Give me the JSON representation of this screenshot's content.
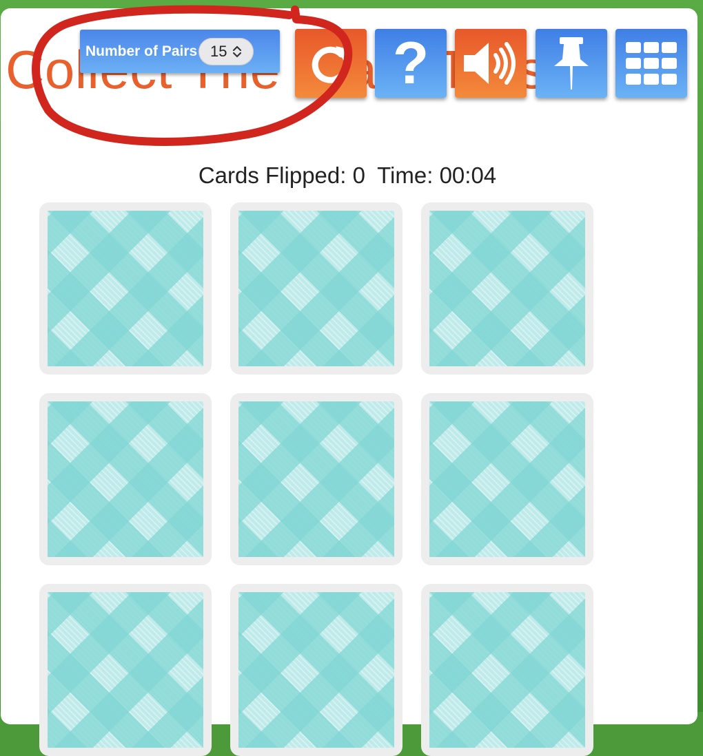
{
  "game": {
    "title": "Collect The Stars Twist",
    "number_of_pairs_label": "Number of Pairs",
    "number_of_pairs_value": "15"
  },
  "toolbar": {
    "buttons": [
      {
        "icon": "restart-icon",
        "color": "orange"
      },
      {
        "icon": "help-icon",
        "glyph": "?",
        "color": "blue"
      },
      {
        "icon": "sound-icon",
        "color": "orange"
      },
      {
        "icon": "pin-icon",
        "color": "blue"
      },
      {
        "icon": "grid-icon",
        "color": "blue"
      }
    ]
  },
  "status": {
    "cards_flipped_label": "Cards Flipped: 0",
    "time_label": "Time: 00:04"
  },
  "cards": {
    "rows": 3,
    "columns": 3,
    "count": 9,
    "state": "face-down"
  },
  "colors": {
    "accent_orange": "#e8602c",
    "accent_blue": "#4a86ea",
    "background_green": "#4c9a3a",
    "annotation_red": "#d1261d",
    "card_pattern": "#9fe0de"
  }
}
